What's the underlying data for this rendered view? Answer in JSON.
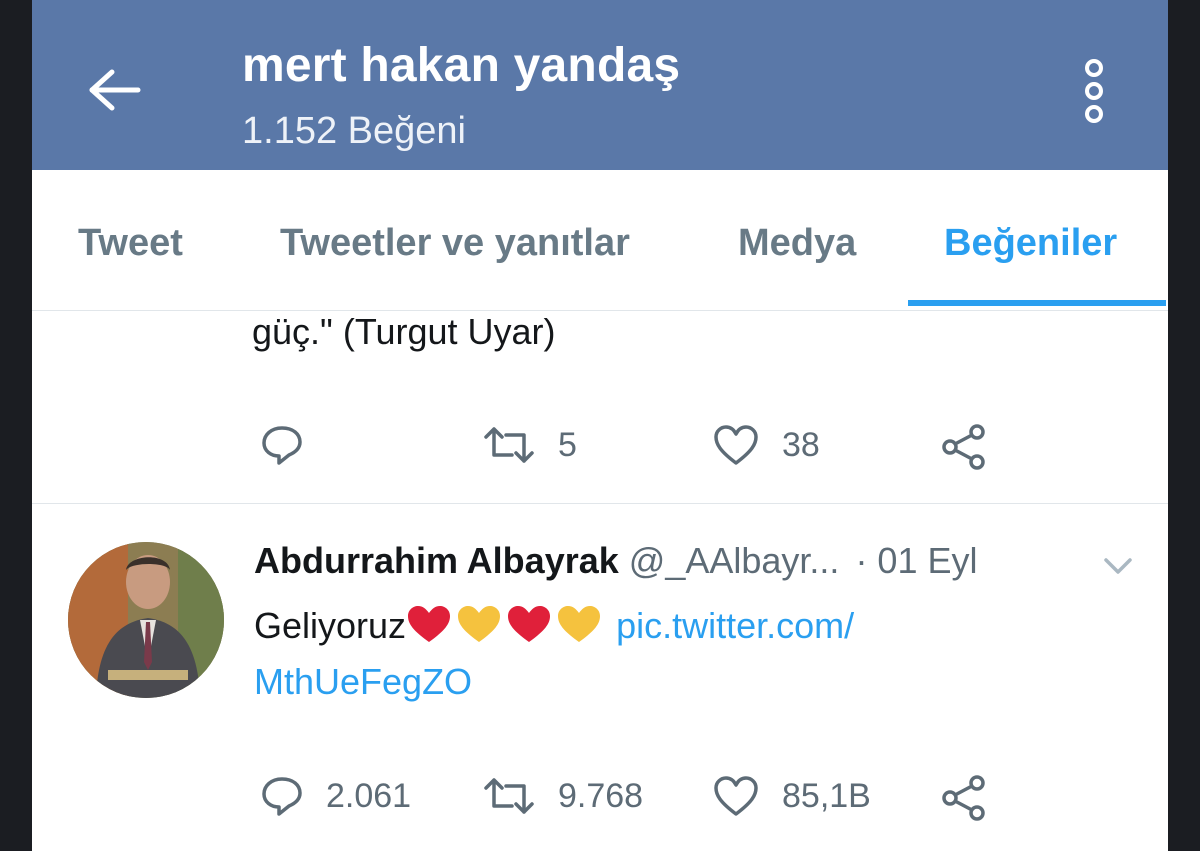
{
  "header": {
    "title": "mert hakan yandaş",
    "subtitle": "1.152 Beğeni"
  },
  "tabs": [
    {
      "label": "Tweet",
      "active": false
    },
    {
      "label": "Tweetler ve yanıtlar",
      "active": false
    },
    {
      "label": "Medya",
      "active": false
    },
    {
      "label": "Beğeniler",
      "active": true
    }
  ],
  "tweet1": {
    "text": "güç.\" (Turgut Uyar)",
    "retweets": "5",
    "likes": "38"
  },
  "tweet2": {
    "name": "Abdurrahim Albayrak",
    "handle": "@_AAlbayr...",
    "date": "· 01 Eyl",
    "text": "Geliyoruz",
    "link_line1": "pic.twitter.com/",
    "link_line2": "MthUeFegZO",
    "replies": "2.061",
    "retweets": "9.768",
    "likes": "85,1B"
  },
  "colors": {
    "header_bg": "#5a78a8",
    "accent": "#2a9ff0",
    "red_heart": "#e0203a",
    "yellow_heart": "#f5c23e"
  }
}
